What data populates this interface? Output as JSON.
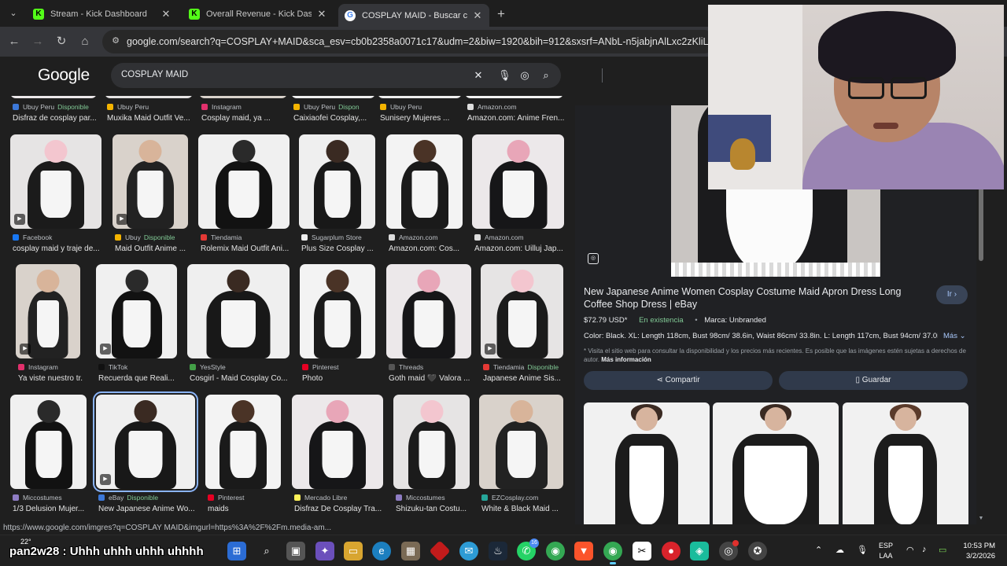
{
  "browser": {
    "tabs": [
      {
        "title": "Stream - Kick Dashboard",
        "favicon": "K",
        "active": false
      },
      {
        "title": "Overall Revenue - Kick Dashboard",
        "favicon": "K",
        "active": false
      },
      {
        "title": "COSPLAY MAID - Buscar con Google",
        "favicon": "G",
        "active": true
      }
    ],
    "new_tab_label": "+",
    "url": "google.com/search?q=COSPLAY+MAID&sca_esv=cb0b2358a0071c17&udm=2&biw=1920&bih=912&sxsrf=ANbL-n5jabjnAlLxc2zKliLbM787rFt"
  },
  "google": {
    "logo": "Google",
    "query": "COSPLAY MAID"
  },
  "results": [
    {
      "source": "Ubuy Peru",
      "available": "Disponible",
      "caption": "Disfraz de cosplay par...",
      "color": "#3c78d8"
    },
    {
      "source": "Ubuy Peru",
      "available": "",
      "caption": "Muxika Maid Outfit Ve...",
      "color": "#f4b400"
    },
    {
      "source": "Instagram",
      "available": "",
      "caption": "Cosplay maid, ya ...",
      "color": "#e1306c"
    },
    {
      "source": "Ubuy Peru",
      "available": "Dispon",
      "caption": "Caixiaofei Cosplay,...",
      "color": "#f4b400"
    },
    {
      "source": "Ubuy Peru",
      "available": "",
      "caption": "Sunisery Mujeres ...",
      "color": "#f4b400"
    },
    {
      "source": "Amazon.com",
      "available": "",
      "caption": "Amazon.com: Anime Fren...",
      "color": "#dddddd"
    },
    {
      "source": "Facebook",
      "available": "",
      "caption": "cosplay maid y traje de...",
      "color": "#1877f2"
    },
    {
      "source": "Ubuy",
      "available": "Disponible",
      "caption": "Maid Outfit Anime ...",
      "color": "#f4b400"
    },
    {
      "source": "Tiendamia",
      "available": "",
      "caption": "Rolemix Maid Outfit Ani...",
      "color": "#e53935"
    },
    {
      "source": "Sugarplum Store",
      "available": "",
      "caption": "Plus Size Cosplay ...",
      "color": "#eeeeee"
    },
    {
      "source": "Amazon.com",
      "available": "",
      "caption": "Amazon.com: Cos...",
      "color": "#dddddd"
    },
    {
      "source": "Amazon.com",
      "available": "",
      "caption": "Amazon.com: Uilluj Jap...",
      "color": "#dddddd"
    },
    {
      "source": "Instagram",
      "available": "",
      "caption": "Ya viste nuestro tr...",
      "color": "#e1306c"
    },
    {
      "source": "TikTok",
      "available": "",
      "caption": "Recuerda que Reali...",
      "color": "#111111"
    },
    {
      "source": "YesStyle",
      "available": "",
      "caption": "Cosgirl - Maid Cosplay Co...",
      "color": "#43a047"
    },
    {
      "source": "Pinterest",
      "available": "",
      "caption": "Photo",
      "color": "#e60023"
    },
    {
      "source": "Threads",
      "available": "",
      "caption": "Goth maid 🖤 Valora ...",
      "color": "#555555"
    },
    {
      "source": "Tiendamia",
      "available": "Disponible",
      "caption": "Japanese Anime Sis...",
      "color": "#e53935"
    },
    {
      "source": "Miccostumes",
      "available": "",
      "caption": "1/3 Delusion Mujer...",
      "color": "#8e7cc3"
    },
    {
      "source": "eBay",
      "available": "Disponible",
      "caption": "New Japanese Anime Wo...",
      "color": "#3c78d8"
    },
    {
      "source": "Pinterest",
      "available": "",
      "caption": "maids",
      "color": "#e60023"
    },
    {
      "source": "Mercado Libre",
      "available": "",
      "caption": "Disfraz De Cosplay Tra...",
      "color": "#fff159"
    },
    {
      "source": "Miccostumes",
      "available": "",
      "caption": "Shizuku-tan Costu...",
      "color": "#8e7cc3"
    },
    {
      "source": "EZCosplay.com",
      "available": "",
      "caption": "White & Black Maid ...",
      "color": "#26a69a"
    }
  ],
  "preview": {
    "title": "New Japanese Anime Women Cosplay Costume Maid Apron Dress Long Coffee Shop Dress | eBay",
    "go_label": "Ir ›",
    "price": "$72.79 USD*",
    "stock": "En existencia",
    "brand": "Marca: Unbranded",
    "specs": "Color: Black. XL: Length 118cm, Bust 98cm/ 38.6in, Waist 86cm/ 33.8in. L: Length 117cm, Bust 94cm/ 37.0i...",
    "more_label": "Más",
    "disclaimer": "* Visita el sitio web para consultar la disponibilidad y los precios más recientes. Es posible que las imágenes estén sujetas a derechos de autor.",
    "more_info": "Más información",
    "share_label": "Compartir",
    "save_label": "Guardar"
  },
  "status_url": "https://www.google.com/imgres?q=COSPLAY MAID&imgurl=https%3A%2F%2Fm.media-am...",
  "taskbar": {
    "weather": "22°",
    "chat_overlay": "pan2w28 : Uhhh uhhh uhhh uhhhh",
    "steam_badge": "16",
    "lang_top": "ESP",
    "lang_bottom": "LAA",
    "time": "10:53 PM",
    "date": "3/2/2026"
  }
}
